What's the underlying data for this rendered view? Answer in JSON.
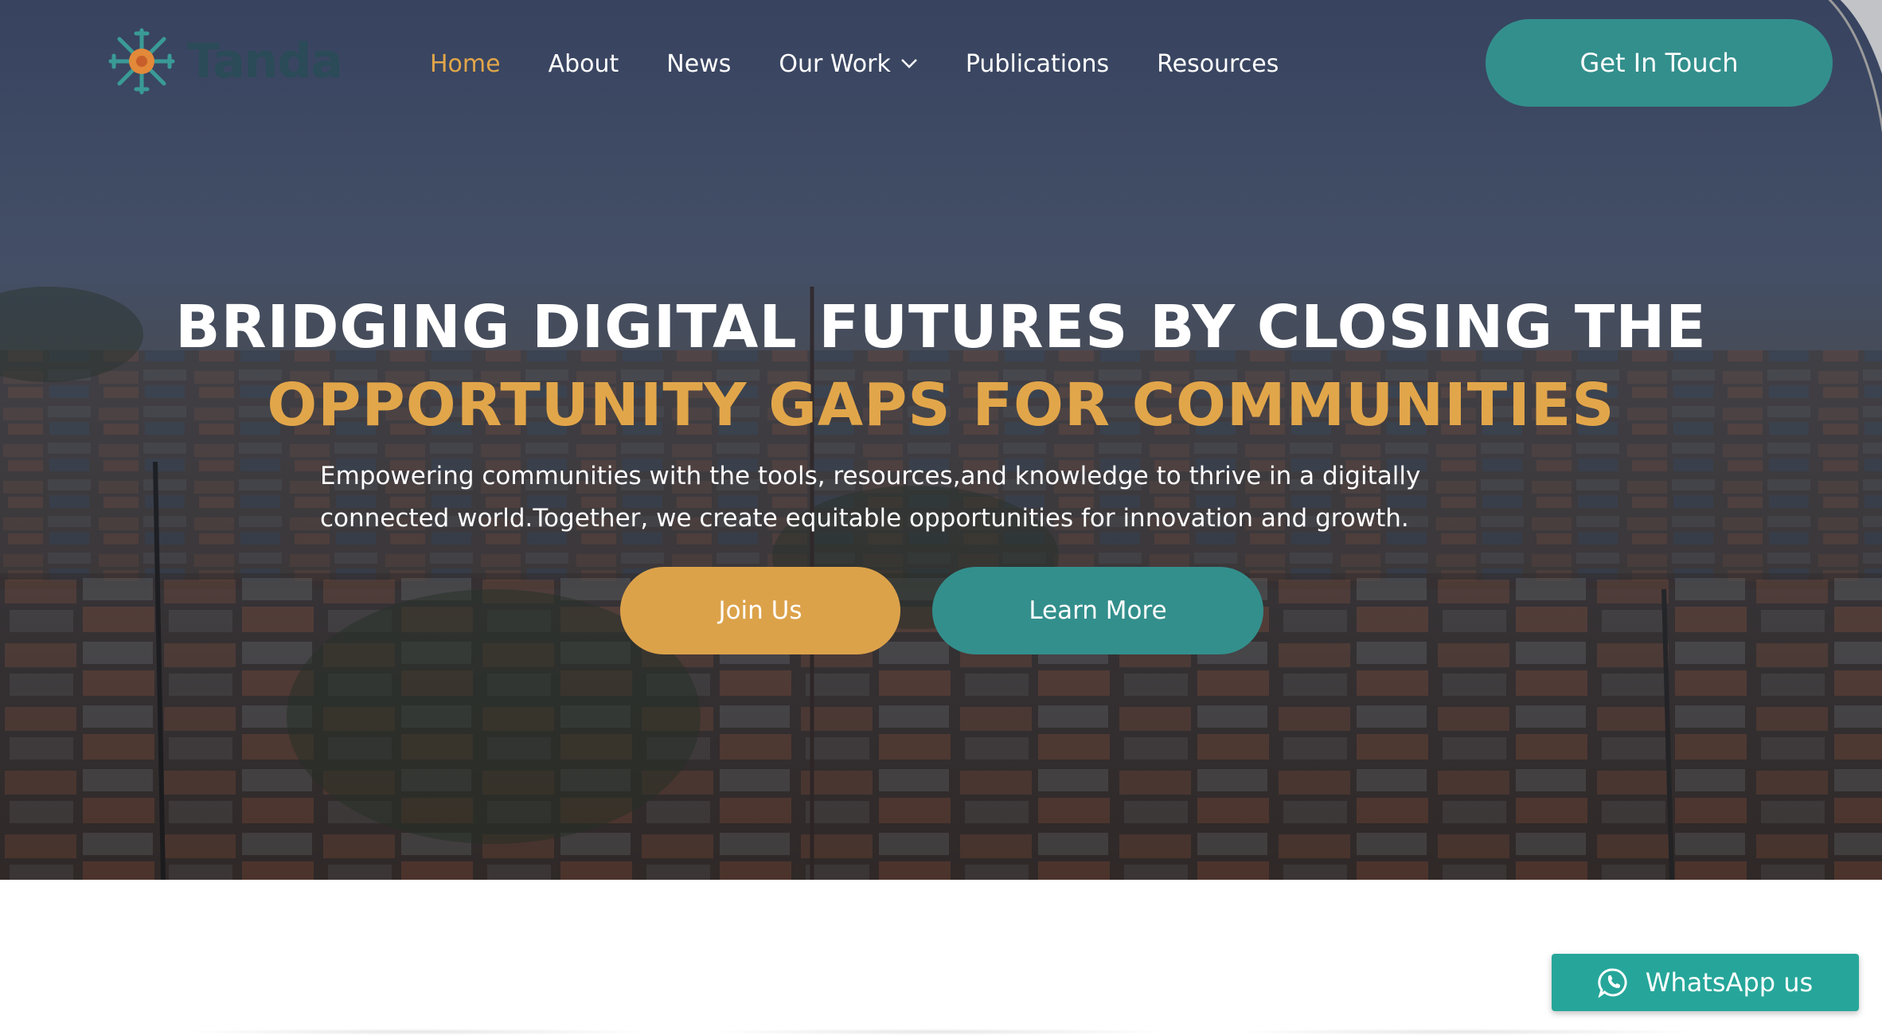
{
  "brand": {
    "name": "Tanda",
    "logo_icon": "snowflake-logo-icon",
    "colors": {
      "teal": "#338f8c",
      "gold": "#e2a64a",
      "dark_text": "#2a4b57"
    }
  },
  "nav": {
    "items": [
      {
        "label": "Home",
        "active": true
      },
      {
        "label": "About",
        "active": false
      },
      {
        "label": "News",
        "active": false
      },
      {
        "label": "Our Work",
        "active": false,
        "has_dropdown": true
      },
      {
        "label": "Publications",
        "active": false
      },
      {
        "label": "Resources",
        "active": false
      }
    ],
    "cta_label": "Get In Touch"
  },
  "hero": {
    "headline_line1": "BRIDGING DIGITAL FUTURES BY CLOSING THE",
    "headline_line2": "OPPORTUNITY GAPS FOR COMMUNITIES",
    "subtext_line1": "Empowering communities with the tools, resources,and knowledge to thrive in a digitally",
    "subtext_line2": "connected world.Together, we create equitable opportunities for innovation and growth.",
    "primary_button": "Join Us",
    "secondary_button": "Learn More"
  },
  "floating": {
    "whatsapp_label": "WhatsApp us",
    "whatsapp_icon": "whatsapp-icon"
  }
}
